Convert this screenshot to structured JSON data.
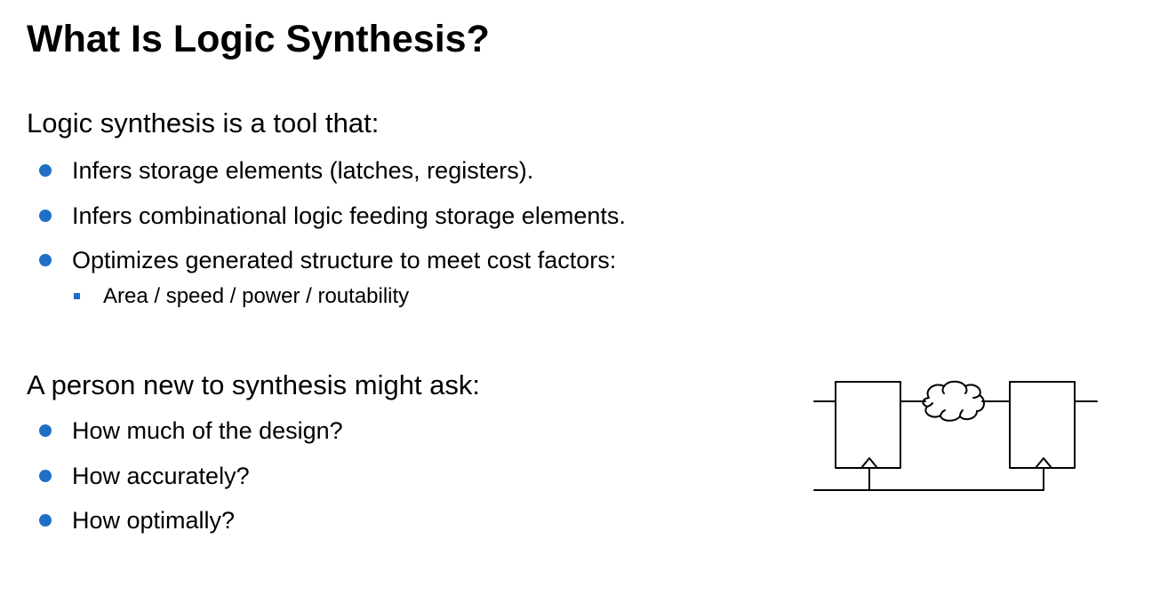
{
  "slide": {
    "title": "What Is Logic Synthesis?",
    "bullet_color": "#1F6FC6",
    "sections": [
      {
        "heading": "Logic synthesis is a tool that:",
        "bullets": [
          "Infers storage elements (latches, registers).",
          "Infers combinational logic feeding storage elements.",
          "Optimizes generated structure to meet cost factors:"
        ],
        "sub_bullets": [
          "Area / speed / power / routability"
        ]
      },
      {
        "heading": "A person new to synthesis might ask:",
        "bullets": [
          "How much of the design?",
          "How accurately?",
          "How optimally?"
        ]
      }
    ]
  },
  "diagram": {
    "elements": [
      "flip-flop",
      "combinational-logic-cloud",
      "flip-flop",
      "shared-clock-line"
    ],
    "stroke_color": "#000000"
  }
}
